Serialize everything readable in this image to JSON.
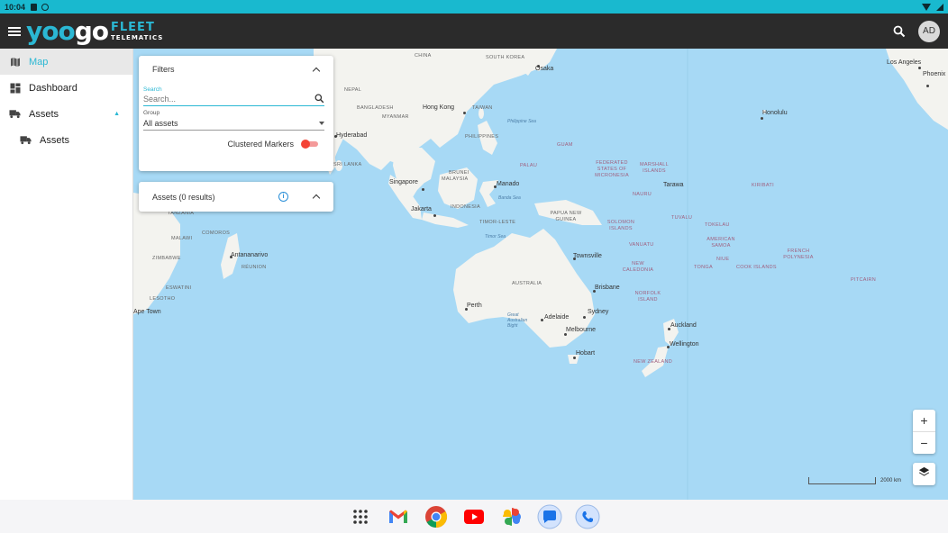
{
  "status_bar": {
    "time": "10:04"
  },
  "app_bar": {
    "logo_main_a": "yoo",
    "logo_main_b": "go",
    "logo_fleet": "FLEET",
    "logo_telematics": "TELEMATICS",
    "avatar_initials": "AD"
  },
  "sidebar": {
    "items": [
      {
        "label": "Map",
        "icon": "map-icon",
        "active": true
      },
      {
        "label": "Dashboard",
        "icon": "dashboard-icon"
      },
      {
        "label": "Assets",
        "icon": "truck-icon",
        "expanded": true
      },
      {
        "label": "Assets",
        "icon": "truck-icon",
        "sub": true
      }
    ]
  },
  "filters": {
    "title": "Filters",
    "search_label": "Search",
    "search_placeholder": "Search...",
    "group_label": "Group",
    "group_value": "All assets",
    "clustered_label": "Clustered Markers",
    "clustered_on": true
  },
  "assets_panel": {
    "title": "Assets (0 results)"
  },
  "map": {
    "cities": [
      {
        "name": "Osaka"
      },
      {
        "name": "Hong Kong"
      },
      {
        "name": "Hyderabad"
      },
      {
        "name": "Singapore"
      },
      {
        "name": "Manado"
      },
      {
        "name": "Jakarta"
      },
      {
        "name": "Antananarivo"
      },
      {
        "name": "Townsville"
      },
      {
        "name": "Brisbane"
      },
      {
        "name": "Perth"
      },
      {
        "name": "Adelaide"
      },
      {
        "name": "Sydney"
      },
      {
        "name": "Melbourne"
      },
      {
        "name": "Hobart"
      },
      {
        "name": "Auckland"
      },
      {
        "name": "Wellington"
      },
      {
        "name": "Honolulu"
      },
      {
        "name": "Los Angeles"
      },
      {
        "name": "Phoenix"
      },
      {
        "name": "Tarawa"
      },
      {
        "name": "Ape Town"
      }
    ],
    "countries": [
      {
        "name": "CHINA"
      },
      {
        "name": "SOUTH KOREA"
      },
      {
        "name": "NEPAL"
      },
      {
        "name": "BANGLADESH"
      },
      {
        "name": "MYANMAR"
      },
      {
        "name": "TAIWAN"
      },
      {
        "name": "PHILIPPINES"
      },
      {
        "name": "SRI LANKA"
      },
      {
        "name": "BRUNEI"
      },
      {
        "name": "MALAYSIA"
      },
      {
        "name": "INDONESIA"
      },
      {
        "name": "TIMOR-LESTE"
      },
      {
        "name": "PAPUA NEW GUINEA"
      },
      {
        "name": "AUSTRALIA"
      },
      {
        "name": "NEW ZEALAND"
      },
      {
        "name": "TANZANIA"
      },
      {
        "name": "COMOROS"
      },
      {
        "name": "MALAWI"
      },
      {
        "name": "ZIMBABWE"
      },
      {
        "name": "ESWATINI"
      },
      {
        "name": "LESOTHO"
      },
      {
        "name": "RÉUNION"
      },
      {
        "name": "GUAM"
      },
      {
        "name": "PALAU"
      },
      {
        "name": "FEDERATED STATES OF MICRONESIA"
      },
      {
        "name": "MARSHALL ISLANDS"
      },
      {
        "name": "NAURU"
      },
      {
        "name": "KIRIBATI"
      },
      {
        "name": "SOLOMON ISLANDS"
      },
      {
        "name": "TUVALU"
      },
      {
        "name": "TOKELAU"
      },
      {
        "name": "AMERICAN SAMOA"
      },
      {
        "name": "VANUATU"
      },
      {
        "name": "NEW CALEDONIA"
      },
      {
        "name": "NIUE"
      },
      {
        "name": "TONGA"
      },
      {
        "name": "COOK ISLANDS"
      },
      {
        "name": "FRENCH POLYNESIA"
      },
      {
        "name": "PITCAIRN"
      },
      {
        "name": "NORFOLK ISLAND"
      }
    ],
    "seas": [
      {
        "name": "Philippine Sea"
      },
      {
        "name": "Timor Sea"
      },
      {
        "name": "Great Australian Bight"
      },
      {
        "name": "Banda Sea"
      }
    ],
    "scale_label": "2000 km"
  },
  "zoom": {
    "in": "+",
    "out": "−"
  },
  "dock": [
    {
      "name": "app-drawer"
    },
    {
      "name": "gmail"
    },
    {
      "name": "chrome"
    },
    {
      "name": "youtube"
    },
    {
      "name": "photos"
    },
    {
      "name": "messages"
    },
    {
      "name": "phone"
    }
  ]
}
